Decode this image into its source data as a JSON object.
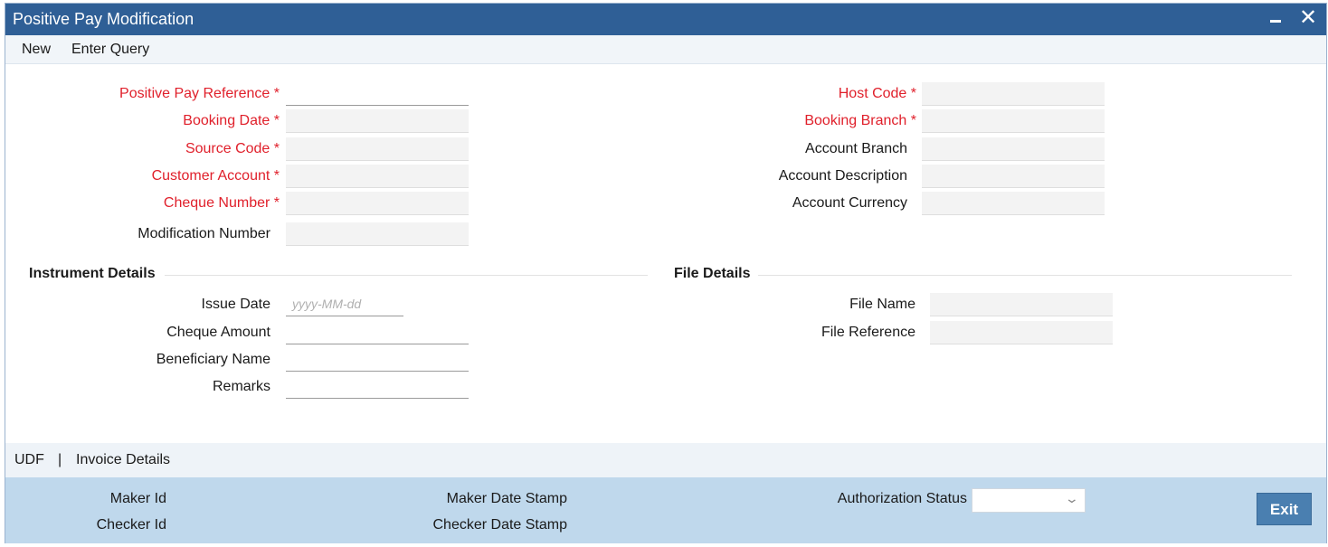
{
  "window": {
    "title": "Positive Pay Modification",
    "minimize": "–",
    "close": "✕"
  },
  "menu": {
    "new": "New",
    "enter_query": "Enter Query"
  },
  "left_fields": {
    "positive_pay_reference": "Positive Pay Reference",
    "booking_date": "Booking Date",
    "source_code": "Source Code",
    "customer_account": "Customer Account",
    "cheque_number": "Cheque Number",
    "modification_number": "Modification Number"
  },
  "right_fields": {
    "host_code": "Host Code",
    "booking_branch": "Booking Branch",
    "account_branch": "Account Branch",
    "account_description": "Account Description",
    "account_currency": "Account Currency"
  },
  "instrument": {
    "title": "Instrument Details",
    "issue_date": "Issue Date",
    "issue_date_placeholder": "yyyy-MM-dd",
    "cheque_amount": "Cheque Amount",
    "beneficiary_name": "Beneficiary Name",
    "remarks": "Remarks"
  },
  "file": {
    "title": "File Details",
    "file_name": "File Name",
    "file_reference": "File Reference"
  },
  "subnav": {
    "udf": "UDF",
    "separator": "|",
    "invoice_details": "Invoice Details"
  },
  "footer": {
    "maker_id": "Maker Id",
    "checker_id": "Checker Id",
    "maker_date_stamp": "Maker Date Stamp",
    "checker_date_stamp": "Checker Date Stamp",
    "authorization_status": "Authorization Status",
    "exit": "Exit"
  },
  "colors": {
    "titlebar": "#2f5f96",
    "required": "#e0202b",
    "footer": "#bfd8ec",
    "button": "#4a7fb0"
  },
  "icons": {
    "minimize": "minimize-icon",
    "close": "close-icon",
    "dropdown": "chevron-down-icon"
  }
}
